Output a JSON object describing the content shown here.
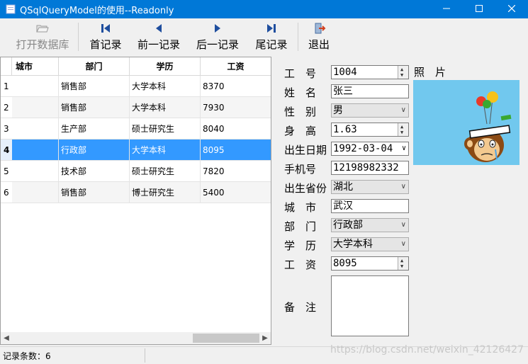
{
  "window": {
    "title": "QSqlQueryModel的使用--Readonly",
    "controls": [
      "minimize",
      "maximize",
      "close"
    ]
  },
  "toolbar": {
    "open_label": "打开数据库",
    "first_label": "首记录",
    "prev_label": "前一记录",
    "next_label": "后一记录",
    "last_label": "尾记录",
    "exit_label": "退出"
  },
  "table": {
    "headers": [
      "城市",
      "部门",
      "学历",
      "工资"
    ],
    "rows": [
      {
        "num": "1",
        "city": "",
        "dept": "销售部",
        "edu": "大学本科",
        "salary": "8370"
      },
      {
        "num": "2",
        "city": "",
        "dept": "销售部",
        "edu": "大学本科",
        "salary": "7930"
      },
      {
        "num": "3",
        "city": "",
        "dept": "生产部",
        "edu": "硕士研究生",
        "salary": "8040"
      },
      {
        "num": "4",
        "city": "",
        "dept": "行政部",
        "edu": "大学本科",
        "salary": "8095"
      },
      {
        "num": "5",
        "city": "",
        "dept": "技术部",
        "edu": "硕士研究生",
        "salary": "7820"
      },
      {
        "num": "6",
        "city": "",
        "dept": "销售部",
        "edu": "博士研究生",
        "salary": "5400"
      }
    ],
    "selected_row": 4
  },
  "form": {
    "labels": {
      "id": "工　号",
      "name": "姓　名",
      "gender": "性　别",
      "height": "身　高",
      "birthday": "出生日期",
      "phone": "手机号",
      "province": "出生省份",
      "city": "城　市",
      "dept": "部　门",
      "edu": "学　历",
      "salary": "工　资",
      "memo": "备　注",
      "photo": "照　片"
    },
    "values": {
      "id": "1004",
      "name": "张三",
      "gender": "男",
      "height": "1.63",
      "birthday": "1992-03-04",
      "phone": "12198982332",
      "province": "湖北",
      "city": "武汉",
      "dept": "行政部",
      "edu": "大学本科",
      "salary": "8095",
      "memo": ""
    }
  },
  "status": {
    "record_count": "记录条数：6"
  },
  "watermark": "https://blog.csdn.net/weixin_42126427",
  "colors": {
    "titlebar": "#0078d7",
    "selection": "#3399ff",
    "photo_bg": "#71c8ee"
  }
}
